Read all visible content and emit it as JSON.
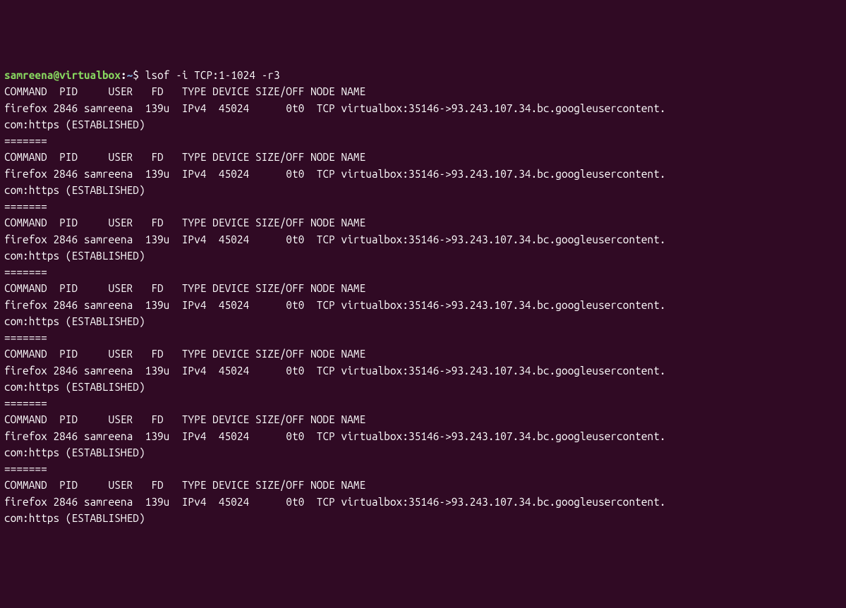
{
  "prompt": {
    "user": "samreena@virtualbox",
    "colon": ":",
    "path": "~",
    "dollar": "$ "
  },
  "command": "lsof -i TCP:1-1024 -r3",
  "header": "COMMAND  PID     USER   FD   TYPE DEVICE SIZE/OFF NODE NAME",
  "dataLine1": "firefox 2846 samreena  139u  IPv4  45024      0t0  TCP virtualbox:35146->93.243.107.34.bc.googleusercontent.",
  "dataLine2": "com:https (ESTABLISHED)",
  "separator": "=======",
  "blocks": 7
}
